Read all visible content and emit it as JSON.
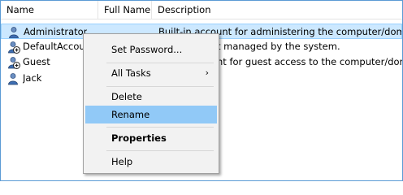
{
  "columns": [
    "Name",
    "Full Name",
    "Description"
  ],
  "rows": [
    {
      "name": "Administrator",
      "full_name": "",
      "description": "Built-in account for administering the computer/domain",
      "selected": true
    },
    {
      "name": "DefaultAccou",
      "full_name": "",
      "description": "t managed by the system."
    },
    {
      "name": "Guest",
      "full_name": "",
      "description": "nt for guest access to the computer/domain"
    },
    {
      "name": "Jack",
      "full_name": "",
      "description": ""
    }
  ],
  "context_menu": {
    "set_password": "Set Password...",
    "all_tasks": "All Tasks",
    "all_tasks_arrow": "›",
    "delete": "Delete",
    "rename": "Rename",
    "properties": "Properties",
    "help": "Help",
    "highlighted": "Rename"
  },
  "colors": {
    "selection_bg": "#cce8ff",
    "menu_hover": "#91c9f7",
    "menu_bg": "#f2f2f2",
    "frame_border": "#5b9bd5"
  }
}
